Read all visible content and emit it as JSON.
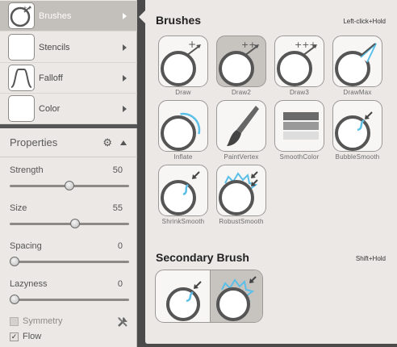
{
  "sidebar": {
    "tools": [
      {
        "label": "Brushes",
        "icon": "brush-draw-icon",
        "active": true
      },
      {
        "label": "Stencils",
        "icon": "stencil-icon",
        "active": false
      },
      {
        "label": "Falloff",
        "icon": "falloff-curve-icon",
        "active": false
      },
      {
        "label": "Color",
        "icon": "color-swatch-icon",
        "active": false
      }
    ]
  },
  "properties": {
    "title": "Properties",
    "sliders": [
      {
        "name": "Strength",
        "value": "50",
        "fraction": 0.5
      },
      {
        "name": "Size",
        "value": "55",
        "fraction": 0.55
      },
      {
        "name": "Spacing",
        "value": "0",
        "fraction": 0.0
      },
      {
        "name": "Lazyness",
        "value": "0",
        "fraction": 0.0
      }
    ],
    "symmetry_label": "Symmetry",
    "symmetry_checked": false,
    "flow_label": "Flow",
    "flow_checked": true,
    "flow_check_glyph": "✓"
  },
  "brushes_panel": {
    "title": "Brushes",
    "hint": "Left-click+Hold",
    "brushes": [
      {
        "label": "Draw",
        "icon": "draw-brush-icon",
        "selected": false
      },
      {
        "label": "Draw2",
        "icon": "draw2-brush-icon",
        "selected": true
      },
      {
        "label": "Draw3",
        "icon": "draw3-brush-icon",
        "selected": false
      },
      {
        "label": "DrawMax",
        "icon": "drawmax-brush-icon",
        "selected": false
      },
      {
        "label": "Inflate",
        "icon": "inflate-brush-icon",
        "selected": false
      },
      {
        "label": "PaintVertex",
        "icon": "paint-vertex-icon",
        "selected": false
      },
      {
        "label": "SmoothColor",
        "icon": "smooth-color-icon",
        "selected": false
      },
      {
        "label": "BubbleSmooth",
        "icon": "bubble-smooth-icon",
        "selected": false
      },
      {
        "label": "ShrinkSmooth",
        "icon": "shrink-smooth-icon",
        "selected": false
      },
      {
        "label": "RobustSmooth",
        "icon": "robust-smooth-icon",
        "selected": false
      }
    ],
    "secondary_title": "Secondary Brush",
    "secondary_hint": "Shift+Hold"
  },
  "colors": {
    "accent_blue": "#5bbfe8",
    "panel_bg": "#ebe8e5",
    "selected_bg": "#c7c3bf"
  }
}
